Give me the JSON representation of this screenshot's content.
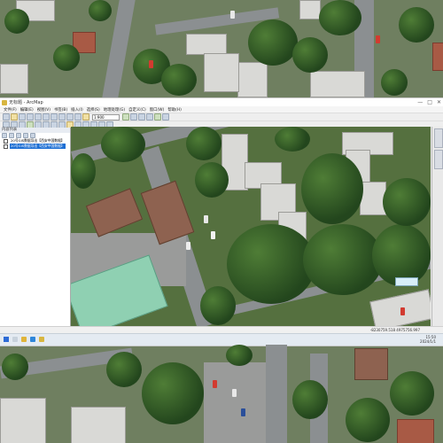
{
  "window": {
    "title": "无标题 - ArcMap",
    "controls": [
      "—",
      "□",
      "✕"
    ]
  },
  "menu": [
    "文件(F)",
    "编辑(E)",
    "视图(V)",
    "书签(B)",
    "插入(I)",
    "选择(S)",
    "地理处理(G)",
    "自定义(C)",
    "窗口(W)",
    "帮助(H)"
  ],
  "toolbar": {
    "scale_value": "1:900"
  },
  "toc": {
    "title": "内容列表",
    "layers": [
      {
        "label": "20号GIS数据导出【西安中国数据】",
        "checked": true,
        "selected": false
      },
      {
        "label": "20号GIS数据导出【西安中国数据】",
        "checked": true,
        "selected": true
      }
    ]
  },
  "statusbar": {
    "coords": "-8230759.518  4975756.997"
  },
  "taskbar": {
    "time": "15:50",
    "date": "2024/1/1"
  },
  "colors": {
    "selection": "#1d6fd4",
    "window_bg": "#f0f0f0",
    "vegetation": "#2f5a22"
  }
}
